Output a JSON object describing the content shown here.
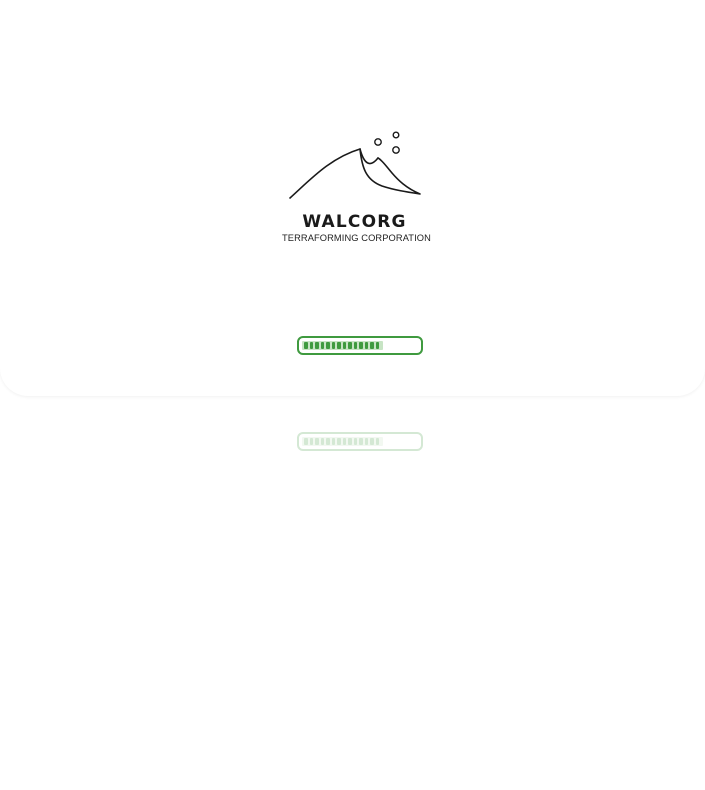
{
  "brand": {
    "name": "WALCORG",
    "tagline": "TERRAFORMING CORPORATION",
    "logo_icon": "mountain-bubbles-icon"
  },
  "progress": {
    "value": 0.7,
    "segments_filled": 14
  },
  "colors": {
    "accent": "#3f9a3f",
    "fill_light": "#c7e4c4",
    "segment": "#3f9a3f",
    "text": "#1a1a1a"
  }
}
